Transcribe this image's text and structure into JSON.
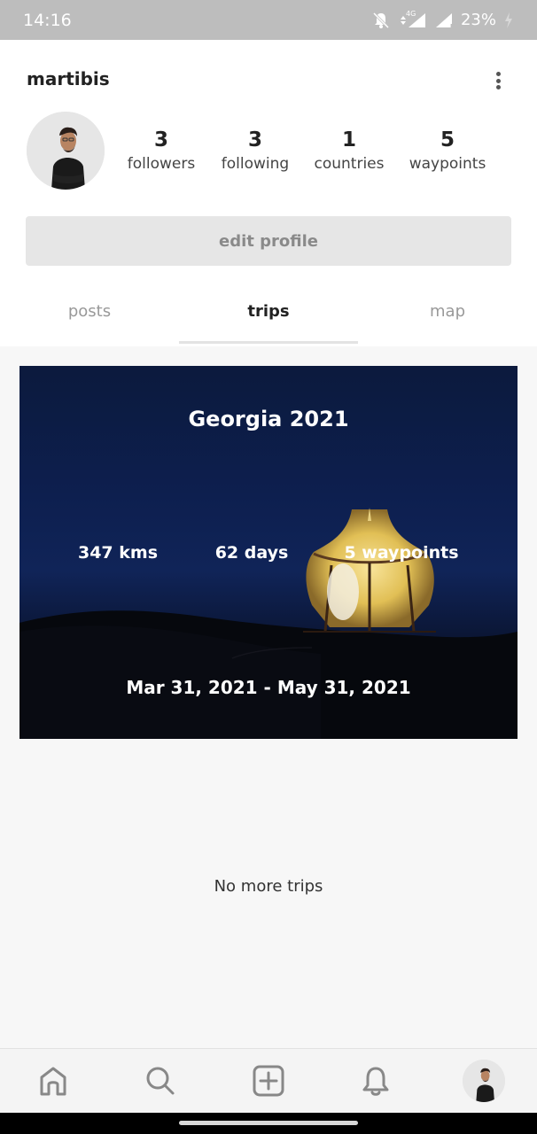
{
  "status_bar": {
    "time": "14:16",
    "battery": "23%",
    "icons": [
      "bell-off-icon",
      "data-arrows-icon",
      "signal-icon",
      "signal-roaming-icon",
      "battery-icon"
    ],
    "network_badge": "4G",
    "roaming_badge": "R"
  },
  "profile": {
    "username": "martibis",
    "stats": [
      {
        "value": "3",
        "label": "followers"
      },
      {
        "value": "3",
        "label": "following"
      },
      {
        "value": "1",
        "label": "countries"
      },
      {
        "value": "5",
        "label": "waypoints"
      }
    ],
    "edit_label": "edit profile"
  },
  "tabs": [
    {
      "label": "posts",
      "active": false
    },
    {
      "label": "trips",
      "active": true
    },
    {
      "label": "map",
      "active": false
    }
  ],
  "trip": {
    "title": "Georgia 2021",
    "distance": "347 kms",
    "duration": "62 days",
    "waypoints": "5 waypoints",
    "dates": "Mar 31, 2021 - May 31, 2021"
  },
  "empty_message": "No more trips",
  "bottom_nav": {
    "items": [
      "home-icon",
      "search-icon",
      "add-icon",
      "bell-icon",
      "avatar"
    ]
  },
  "colors": {
    "status_bar": "#bdbdbd",
    "card_bg": "#0d1f4f",
    "tent_glow": "#f2d26b"
  }
}
